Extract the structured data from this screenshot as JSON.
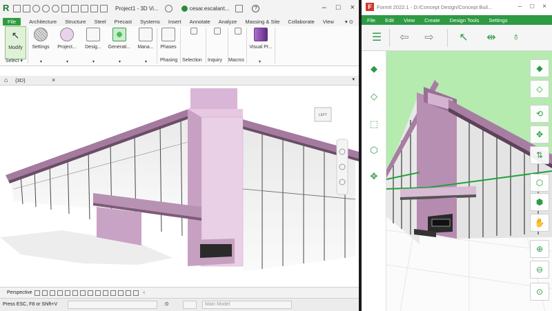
{
  "revit": {
    "title": "Project1 - 3D Vi...",
    "user": "cesar.escalant...",
    "menu_tabs": [
      "File",
      "Architecture",
      "Structure",
      "Steel",
      "Precast",
      "Systems",
      "Insert",
      "Annotate",
      "Analyze",
      "Massing & Site",
      "Collaborate",
      "View"
    ],
    "ribbon_buttons": [
      "Modify",
      "Settings",
      "Project...",
      "Desig...",
      "Generati...",
      "Mana...",
      "Phases",
      "Visual Pr..."
    ],
    "panel_labels": [
      "Select",
      "Phasing",
      "Selection",
      "Inquiry",
      "Macros"
    ],
    "view_tab": "{3D}",
    "view_cube_label": "LEFT",
    "view_control": "Perspective",
    "status_text": "Press ESC, F8 or Shift+V",
    "status_zero": ":0",
    "main_model": "Main Model"
  },
  "formit": {
    "title": "FormIt 2022.1 - D:/Concept Design/Concept Buil...",
    "menu": [
      "File",
      "Edit",
      "View",
      "Create",
      "Design Tools",
      "Settings"
    ],
    "logo_letter": "F"
  },
  "colors": {
    "revit_green": "#2e9d3e",
    "formit_green": "#2d9a44",
    "model_purple": "#b07aa8",
    "sky_green": "#b6ebb0"
  },
  "icons": [
    "revit-logo",
    "open-icon",
    "save-icon",
    "undo-icon",
    "redo-icon",
    "print-icon",
    "binoculars-icon",
    "user-icon",
    "help-icon",
    "select-arrow-icon",
    "orbit-icon",
    "zoom-icon",
    "view-cube-icon",
    "formit-logo"
  ]
}
